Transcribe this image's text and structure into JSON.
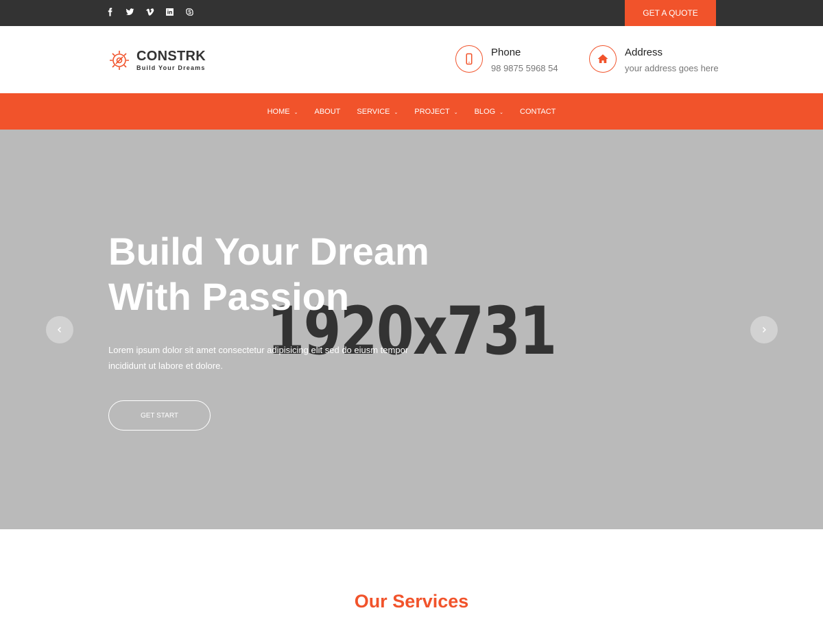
{
  "topbar": {
    "social_icons": [
      "facebook-icon",
      "twitter-icon",
      "vimeo-icon",
      "linkedin-icon",
      "skype-icon"
    ],
    "quote_button": "GET A QUOTE"
  },
  "header": {
    "logo": {
      "name": "CONSTRK",
      "tagline": "Build Your Dreams"
    },
    "phone": {
      "title": "Phone",
      "value": "98 9875 5968 54",
      "icon": "phone-icon"
    },
    "address": {
      "title": "Address",
      "value": "your address goes here",
      "icon": "home-icon"
    }
  },
  "nav": {
    "items": [
      {
        "label": "HOME",
        "dropdown": true
      },
      {
        "label": "ABOUT",
        "dropdown": false
      },
      {
        "label": "SERVICE",
        "dropdown": true
      },
      {
        "label": "PROJECT",
        "dropdown": true
      },
      {
        "label": "BLOG",
        "dropdown": true
      },
      {
        "label": "CONTACT",
        "dropdown": false
      }
    ]
  },
  "hero": {
    "placeholder_text": "1920x731",
    "title_line1": "Build Your Dream",
    "title_line2": "With Passion",
    "text_line1": "Lorem ipsum dolor sit amet consectetur adipisicing elit sed do eiusm tempor",
    "text_line2": "incididunt ut labore et dolore.",
    "button": "GET START"
  },
  "services": {
    "title": "Our Services"
  },
  "colors": {
    "accent": "#f1532b",
    "topbar": "#333333",
    "hero_bg": "#bababa"
  }
}
